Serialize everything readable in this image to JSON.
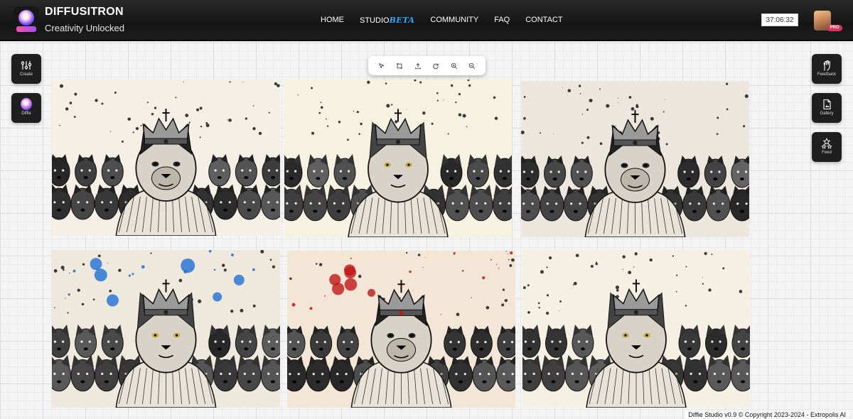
{
  "header": {
    "brand_title": "DIFFUSITRON",
    "brand_subtitle": "Creativity Unlocked",
    "timer": "37:06:32",
    "pro_badge": "PRO"
  },
  "nav": {
    "home": "HOME",
    "studio": "STUDIO",
    "studio_badge": "BETA",
    "community": "COMMUNITY",
    "faq": "FAQ",
    "contact": "CONTACT"
  },
  "left_sidebar": {
    "create_label": "Create",
    "diffie_label": "Diffie"
  },
  "right_sidebar": {
    "feedback_label": "Feedback",
    "gallery_label": "Gallery",
    "feed_label": "Feed"
  },
  "toolbar": {
    "tools": [
      "select-icon",
      "crop-icon",
      "upload-icon",
      "refresh-icon",
      "zoom-in-icon",
      "zoom-out-icon"
    ]
  },
  "gallery": {
    "images": [
      {
        "subject": "dog",
        "background": "#f6efe6",
        "splash": ""
      },
      {
        "subject": "cat",
        "background": "#f7f1e2",
        "splash": ""
      },
      {
        "subject": "dog",
        "background": "#ece6dd",
        "splash": ""
      },
      {
        "subject": "cat",
        "background": "#efe8dc",
        "splash": "#1f6fd6"
      },
      {
        "subject": "dog",
        "background": "#f3e6d6",
        "splash": "#c01818"
      },
      {
        "subject": "cat",
        "background": "#f6efe3",
        "splash": ""
      }
    ]
  },
  "footer": {
    "copyright": "Diffie Studio v0.9 © Copyright 2023-2024 - Extropolis AI"
  },
  "colors": {
    "header_bg": "#1b1b1b",
    "accent_blue": "#2ea7ff",
    "pro_red": "#d8365a"
  }
}
